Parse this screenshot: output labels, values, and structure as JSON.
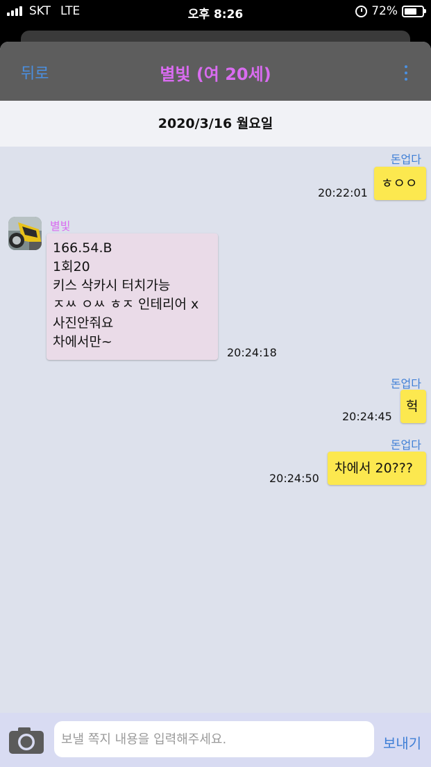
{
  "status_bar": {
    "carrier": "SKT",
    "network": "LTE",
    "time": "오후 8:26",
    "battery": "72%",
    "battery_level": 0.72
  },
  "header": {
    "back_label": "뒤로",
    "title": "별빛 (여 20세)",
    "more_icon": "vertical-ellipsis-icon"
  },
  "date_label": "2020/3/16 월요일",
  "messages": [
    {
      "sender": "돈업다",
      "text": "ㅎㅇㅇ",
      "time": "20:22:01"
    },
    {
      "sender": "별빛",
      "lines": [
        "166.54.B",
        "1회20",
        "키스 삭카시 터치가능",
        "ㅈㅆ ㅇㅆ ㅎㅈ 인테리어 x",
        "사진안줘요",
        "차에서만~"
      ],
      "time": "20:24:18"
    },
    {
      "sender": "돈업다",
      "text": "헉",
      "time": "20:24:45"
    },
    {
      "sender": "돈업다",
      "text": "차에서 20???",
      "time": "20:24:50"
    }
  ],
  "input": {
    "placeholder": "보낼 쪽지 내용을 입력해주세요.",
    "value": "",
    "send_label": "보내기",
    "camera_icon": "camera-icon"
  },
  "colors": {
    "accent_blue": "#4a90e2",
    "partner_pink": "#d96cf0",
    "my_bubble": "#fce84f",
    "partner_bubble": "#eadbe8",
    "chat_bg": "#dde1ec"
  }
}
